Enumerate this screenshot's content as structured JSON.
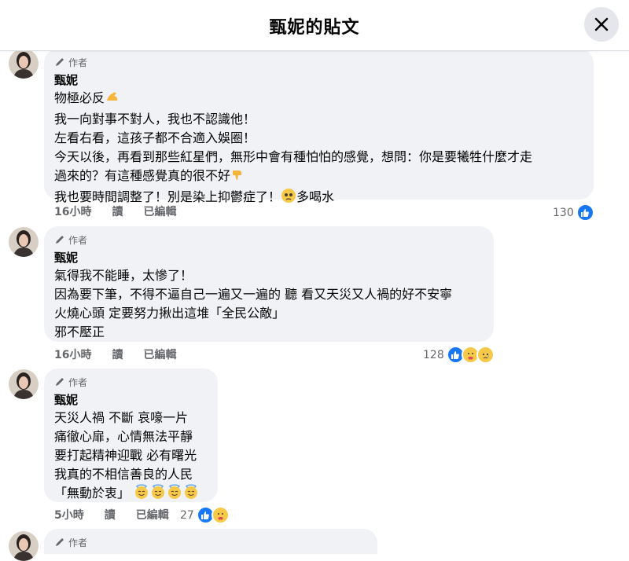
{
  "header": {
    "title": "甄妮的貼文"
  },
  "author_badge": "作者",
  "comments": [
    {
      "name": "甄妮",
      "lines": [
        "物極必反",
        "我一向對事不對人，我也不認識他！",
        "左看右看，這孩子都不合適入娛圈！",
        "今天以後，再看到那些紅星們，無形中會有種怕怕的感覺，想問：你是要犧牲什麼才走",
        "過來的？有這種感覺真的很不好",
        "我也要時間調整了！別是染上抑鬱症了！",
        "多喝水"
      ],
      "time": "16小時",
      "action_read": "讀",
      "edited": "已編輯",
      "reaction_count": "130",
      "emoji": [
        "flexed-biceps",
        "thumbs-down",
        "pleading-face"
      ]
    },
    {
      "name": "甄妮",
      "lines": [
        "氣得我不能睡，太慘了！",
        "因為要下筆，不得不逼自己一遍又一遍的 聽 看又天災又人禍的好不安寧",
        "火燒心頭 定要努力揪出這堆「全民公敵」",
        "邪不壓正"
      ],
      "time": "16小時",
      "action_read": "讀",
      "edited": "已編輯",
      "reaction_count": "128",
      "emoji": [
        "like-reaction",
        "care-reaction",
        "sad-reaction"
      ]
    },
    {
      "name": "甄妮",
      "lines": [
        "天災人禍 不斷 哀嚎一片",
        "痛徹心扉，心情無法平靜",
        "要打起精神迎戰 必有曙光",
        "我真的不相信善良的人民",
        "「無動於衷」"
      ],
      "time": "5小時",
      "action_read": "讀",
      "edited": "已編輯",
      "reaction_count": "27",
      "emoji": [
        "smiling-face-with-halo",
        "like-reaction",
        "care-reaction"
      ]
    }
  ],
  "colors": {
    "like_blue": "#1877f2",
    "bubble_bg": "#f0f2f5",
    "secondary_text": "#65676b"
  }
}
